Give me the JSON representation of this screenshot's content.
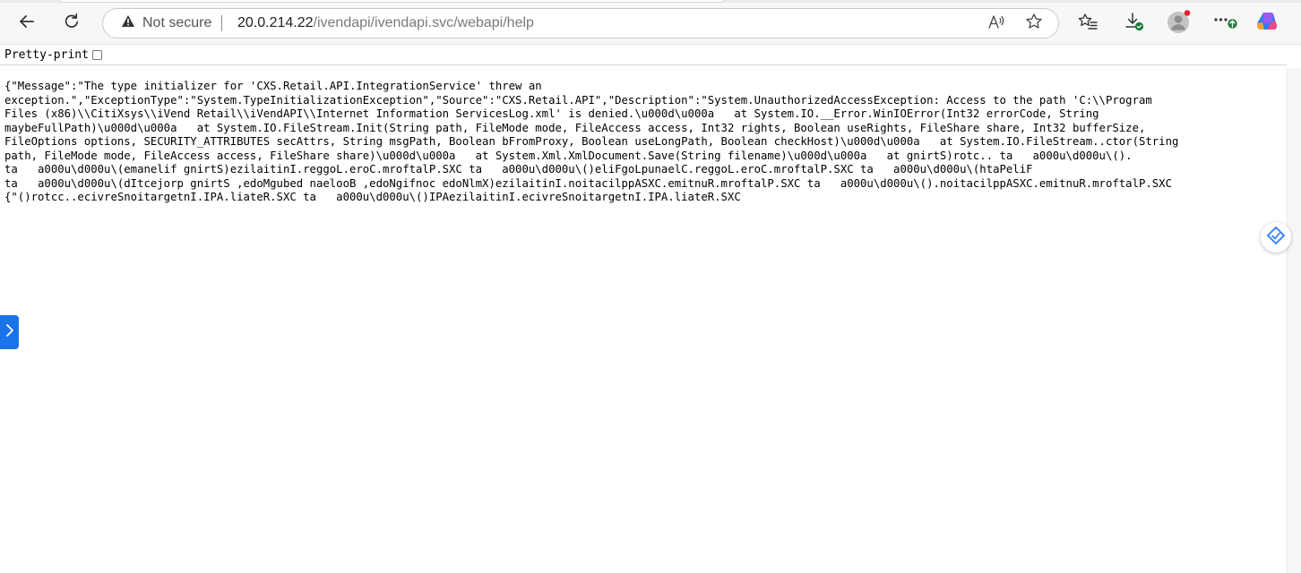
{
  "browser": {
    "security_label": "Not secure",
    "url_host": "20.0.214.22",
    "url_path": "/ivendapi/ivendapi.svc/webapi/help",
    "icons": {
      "back": "back-arrow-icon",
      "refresh": "refresh-icon",
      "warning": "warning-icon",
      "read_aloud": "read-aloud-icon",
      "favorite": "star-icon",
      "favorites_list": "favorites-icon",
      "downloads": "download-icon",
      "profile": "profile-icon",
      "more": "more-icon",
      "copilot": "copilot-icon"
    },
    "colors": {
      "accent": "#1a73e8",
      "update_badge": "#1e7b3a",
      "notify_dot": "#e3262e"
    }
  },
  "page": {
    "pretty_print_label": "Pretty-print",
    "pretty_print_checked": false,
    "json_lines": [
      "{\"Message\":\"The type initializer for 'CXS.Retail.API.IntegrationService' threw an",
      "exception.\",\"ExceptionType\":\"System.TypeInitializationException\",\"Source\":\"CXS.Retail.API\",\"Description\":\"System.UnauthorizedAccessException: Access to the path 'C:\\\\Program",
      "Files (x86)\\\\CitiXsys\\\\iVend Retail\\\\iVendAPI\\\\Internet Information ServicesLog.xml' is denied.\\u000d\\u000a   at System.IO.__Error.WinIOError(Int32 errorCode, String",
      "maybeFullPath)\\u000d\\u000a   at System.IO.FileStream.Init(String path, FileMode mode, FileAccess access, Int32 rights, Boolean useRights, FileShare share, Int32 bufferSize,",
      "FileOptions options, SECURITY_ATTRIBUTES secAttrs, String msgPath, Boolean bFromProxy, Boolean useLongPath, Boolean checkHost)\\u000d\\u000a   at System.IO.FileStream..ctor(String",
      "path, FileMode mode, FileAccess access, FileShare share)\\u000d\\u000a   at System.Xml.XmlDocument.Save(String filename)\\u000d\\u000a   at gnirtS)rotc.. ta   a000u\\d000u\\().",
      "ta   a000u\\d000u\\(emanelif gnirtS)ezilaitinI.reggoL.eroC.mroftalP.SXC ta   a000u\\d000u\\()eliFgoLpunaelC.reggoL.eroC.mroftalP.SXC ta   a000u\\d000u\\(htaPeliF",
      "ta   a000u\\d000u\\(dItcejorp gnirtS ,edoMgubed naelooB ,edoNgifnoc edoNlmX)ezilaitinI.noitacilppASXC.emitnuR.mroftalP.SXC ta   a000u\\d000u\\().noitacilppASXC.emitnuR.mroftalP.SXC",
      "{\"()rotcc..ecivreSnoitargetnI.IPA.liateR.SXC ta   a000u\\d000u\\()IPAezilaitinI.ecivreSnoitargetnI.IPA.liateR.SXC"
    ],
    "side_icons": {
      "left_tab": "chevron-right-icon",
      "right_float": "sidebar-assist-icon"
    }
  }
}
